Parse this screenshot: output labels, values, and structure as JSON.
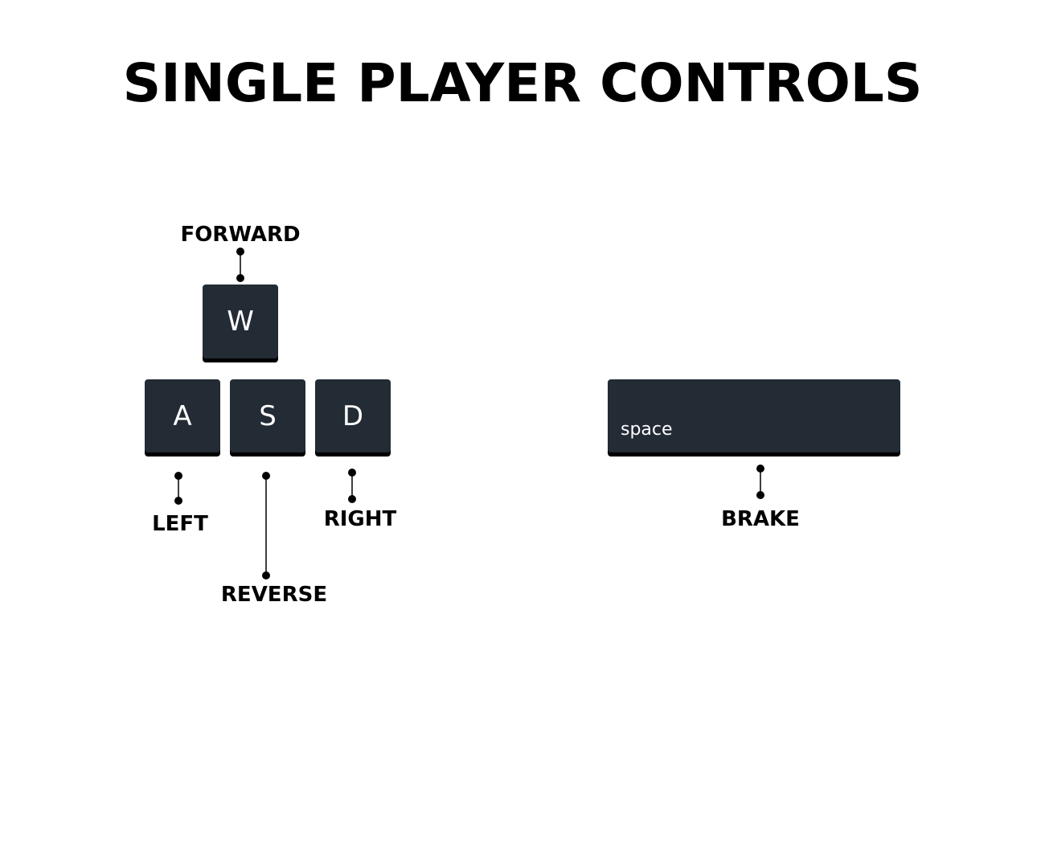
{
  "title": "SINGLE PLAYER CONTROLS",
  "keys": {
    "w": {
      "cap": "W",
      "action": "FORWARD"
    },
    "a": {
      "cap": "A",
      "action": "LEFT"
    },
    "s": {
      "cap": "S",
      "action": "REVERSE"
    },
    "d": {
      "cap": "D",
      "action": "RIGHT"
    },
    "space": {
      "cap": "space",
      "action": "BRAKE"
    }
  },
  "colors": {
    "key_face": "#232b35",
    "key_shadow": "#000000",
    "key_text": "#ffffff",
    "label_text": "#000000",
    "connector": "#000000"
  }
}
